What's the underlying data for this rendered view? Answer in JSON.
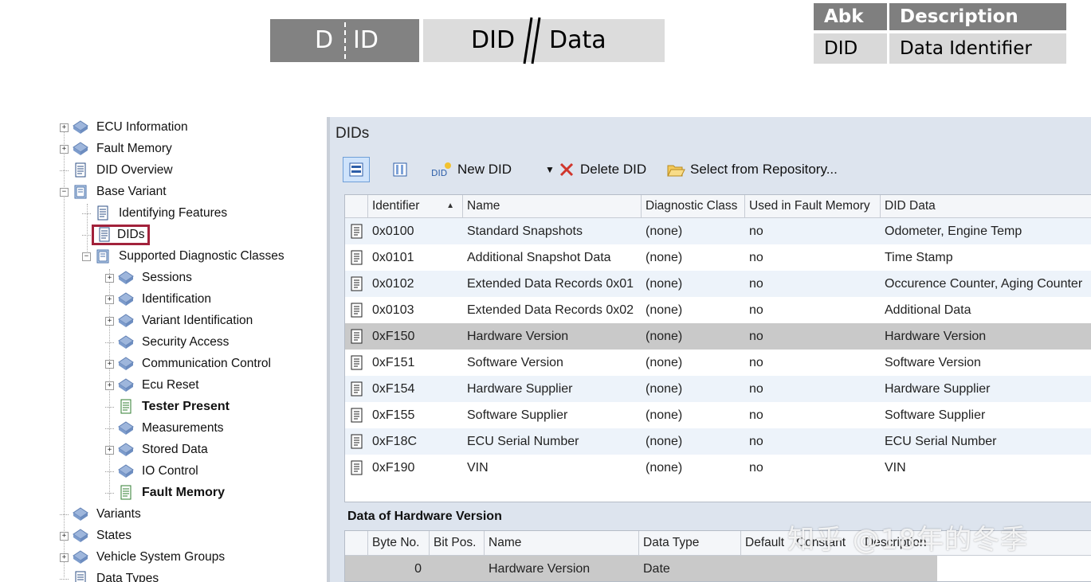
{
  "banner": {
    "did_d": "D",
    "did_id": "ID",
    "data_left": "DID",
    "data_right": "Data"
  },
  "abk_table": {
    "headers": [
      "Abk",
      "Description"
    ],
    "rows": [
      [
        "DID",
        "Data Identifier"
      ]
    ]
  },
  "tree": {
    "items": [
      {
        "label": "ECU Information"
      },
      {
        "label": "Fault Memory"
      },
      {
        "label": "DID Overview"
      },
      {
        "label": "Base Variant"
      },
      {
        "label": "Identifying Features"
      },
      {
        "label": "DIDs"
      },
      {
        "label": "Supported Diagnostic Classes"
      },
      {
        "label": "Sessions"
      },
      {
        "label": "Identification"
      },
      {
        "label": "Variant Identification"
      },
      {
        "label": "Security Access"
      },
      {
        "label": "Communication Control"
      },
      {
        "label": "Ecu Reset"
      },
      {
        "label": "Tester Present"
      },
      {
        "label": "Measurements"
      },
      {
        "label": "Stored Data"
      },
      {
        "label": "IO Control"
      },
      {
        "label": "Fault Memory"
      },
      {
        "label": "Variants"
      },
      {
        "label": "States"
      },
      {
        "label": "Vehicle System Groups"
      },
      {
        "label": "Data Types"
      }
    ]
  },
  "panel": {
    "title": "DIDs",
    "toolbar": {
      "new_did": "New DID",
      "new_did_icon_text": "DID",
      "delete_did": "Delete DID",
      "select_repo": "Select from Repository..."
    },
    "columns": [
      "Identifier",
      "Name",
      "Diagnostic Class",
      "Used in Fault Memory",
      "DID Data"
    ],
    "rows": [
      {
        "id": "0x0100",
        "name": "Standard Snapshots",
        "class": "(none)",
        "fault": "no",
        "data": "Odometer, Engine Temp"
      },
      {
        "id": "0x0101",
        "name": "Additional Snapshot Data",
        "class": "(none)",
        "fault": "no",
        "data": "Time Stamp"
      },
      {
        "id": "0x0102",
        "name": "Extended Data Records 0x01",
        "class": "(none)",
        "fault": "no",
        "data": "Occurence Counter, Aging Counter"
      },
      {
        "id": "0x0103",
        "name": "Extended Data Records 0x02",
        "class": "(none)",
        "fault": "no",
        "data": "Additional Data"
      },
      {
        "id": "0xF150",
        "name": "Hardware Version",
        "class": "(none)",
        "fault": "no",
        "data": "Hardware Version"
      },
      {
        "id": "0xF151",
        "name": "Software Version",
        "class": "(none)",
        "fault": "no",
        "data": "Software Version"
      },
      {
        "id": "0xF154",
        "name": "Hardware Supplier",
        "class": "(none)",
        "fault": "no",
        "data": "Hardware Supplier"
      },
      {
        "id": "0xF155",
        "name": "Software Supplier",
        "class": "(none)",
        "fault": "no",
        "data": "Software Supplier"
      },
      {
        "id": "0xF18C",
        "name": "ECU Serial Number",
        "class": "(none)",
        "fault": "no",
        "data": "ECU Serial Number"
      },
      {
        "id": "0xF190",
        "name": "VIN",
        "class": "(none)",
        "fault": "no",
        "data": "VIN"
      }
    ],
    "sub_title": "Data of Hardware Version",
    "sub_columns": [
      "Byte No.",
      "Bit Pos.",
      "Name",
      "Data Type",
      "Default",
      "Constant",
      "Description"
    ],
    "sub_rows": [
      {
        "byte": "0",
        "bit": "",
        "name": "Hardware Version",
        "type": "Date",
        "default": "",
        "constant": "",
        "description": ""
      }
    ]
  },
  "watermark": "知乎 @18年的冬季",
  "colors": {
    "selection_outline": "#a2223b",
    "panel_bg": "#dde4ee",
    "selected_row": "#c9c9c9",
    "banner_dark": "#828282",
    "banner_light": "#dcdcdc"
  }
}
